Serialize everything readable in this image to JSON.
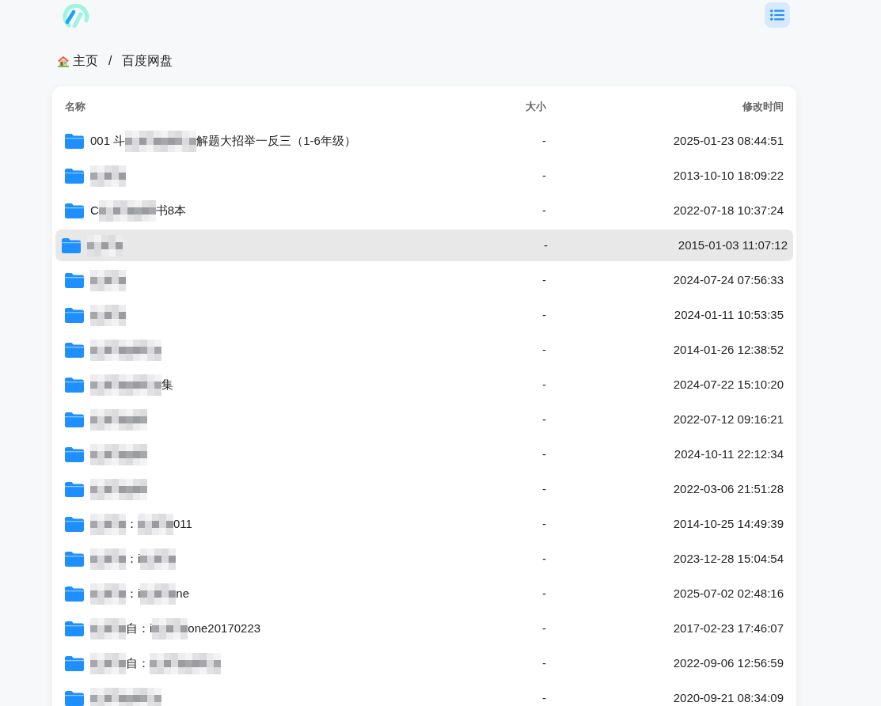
{
  "breadcrumb": {
    "separator": "/",
    "items": [
      {
        "kind": "home",
        "label": "主页"
      },
      {
        "kind": "folder",
        "label": "百度网盘"
      }
    ]
  },
  "table": {
    "columns": [
      "名称",
      "大小",
      "修改时间"
    ],
    "rows": [
      {
        "name": [
          {
            "kind": "text",
            "text": "001 斗"
          },
          {
            "kind": "blur_l"
          },
          {
            "kind": "text",
            "text": "解题大招举一反三（1-6年级）"
          }
        ],
        "size": "-",
        "modified": "2025-01-23 08:44:51",
        "highlighted": false
      },
      {
        "name": [
          {
            "kind": "blur_s"
          }
        ],
        "size": "-",
        "modified": "2013-10-10 18:09:22",
        "highlighted": false
      },
      {
        "name": [
          {
            "kind": "text",
            "text": "C"
          },
          {
            "kind": "blur_m"
          },
          {
            "kind": "text",
            "text": "书8本"
          }
        ],
        "size": "-",
        "modified": "2022-07-18 10:37:24",
        "highlighted": false
      },
      {
        "name": [
          {
            "kind": "blur_s"
          }
        ],
        "size": "-",
        "modified": "2015-01-03 11:07:12",
        "highlighted": true
      },
      {
        "name": [
          {
            "kind": "blur_s"
          }
        ],
        "size": "-",
        "modified": "2024-07-24 07:56:33",
        "highlighted": false
      },
      {
        "name": [
          {
            "kind": "blur_s"
          }
        ],
        "size": "-",
        "modified": "2024-01-11 10:53:35",
        "highlighted": false
      },
      {
        "name": [
          {
            "kind": "blur_l"
          }
        ],
        "size": "-",
        "modified": "2014-01-26 12:38:52",
        "highlighted": false
      },
      {
        "name": [
          {
            "kind": "blur_l"
          },
          {
            "kind": "text",
            "text": "集"
          }
        ],
        "size": "-",
        "modified": "2024-07-22 15:10:20",
        "highlighted": false
      },
      {
        "name": [
          {
            "kind": "blur_m"
          }
        ],
        "size": "-",
        "modified": "2022-07-12 09:16:21",
        "highlighted": false
      },
      {
        "name": [
          {
            "kind": "blur_m"
          }
        ],
        "size": "-",
        "modified": "2024-10-11 22:12:34",
        "highlighted": false
      },
      {
        "name": [
          {
            "kind": "blur_m"
          }
        ],
        "size": "-",
        "modified": "2022-03-06 21:51:28",
        "highlighted": false
      },
      {
        "name": [
          {
            "kind": "blur_s"
          },
          {
            "kind": "text",
            "text": "："
          },
          {
            "kind": "blur_s"
          },
          {
            "kind": "text",
            "text": "011"
          }
        ],
        "size": "-",
        "modified": "2014-10-25 14:49:39",
        "highlighted": false
      },
      {
        "name": [
          {
            "kind": "blur_s"
          },
          {
            "kind": "text",
            "text": "：i"
          },
          {
            "kind": "blur_s"
          }
        ],
        "size": "-",
        "modified": "2023-12-28 15:04:54",
        "highlighted": false
      },
      {
        "name": [
          {
            "kind": "blur_s"
          },
          {
            "kind": "text",
            "text": "：i"
          },
          {
            "kind": "blur_s"
          },
          {
            "kind": "text",
            "text": "ne"
          }
        ],
        "size": "-",
        "modified": "2025-07-02 02:48:16",
        "highlighted": false
      },
      {
        "name": [
          {
            "kind": "blur_s"
          },
          {
            "kind": "text",
            "text": "自：i"
          },
          {
            "kind": "blur_s"
          },
          {
            "kind": "text",
            "text": "one20170223"
          }
        ],
        "size": "-",
        "modified": "2017-02-23 17:46:07",
        "highlighted": false
      },
      {
        "name": [
          {
            "kind": "blur_s"
          },
          {
            "kind": "text",
            "text": "自："
          },
          {
            "kind": "blur_l"
          }
        ],
        "size": "-",
        "modified": "2022-09-06 12:56:59",
        "highlighted": false
      },
      {
        "name": [
          {
            "kind": "blur_l"
          }
        ],
        "size": "-",
        "modified": "2020-09-21 08:34:09",
        "highlighted": false
      }
    ]
  }
}
